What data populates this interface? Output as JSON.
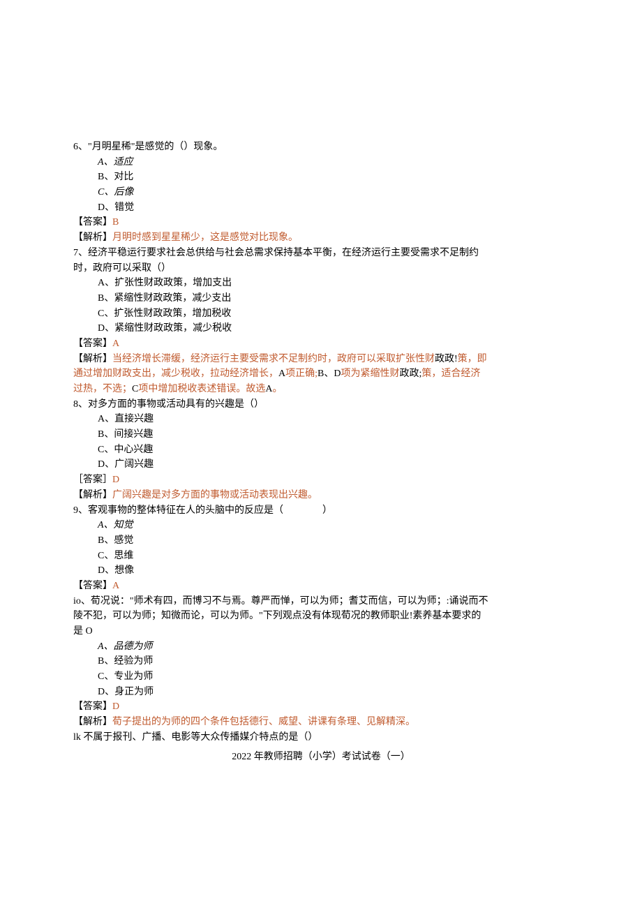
{
  "q6": {
    "stem": "6、\"月明星稀\"是感觉的（）现象。",
    "opts": {
      "A": "A、适应",
      "B": "B、对比",
      "C": "C、后像",
      "D": "D、错觉"
    },
    "ansLabel": "【答案】",
    "ansValue": "B",
    "explLabel": "【解析】",
    "explBody": "月明时感到星星稀少，这是感觉对比现象。"
  },
  "q7": {
    "stem1": "7、经济平稳运行要求社会总供给与社会总需求保持基本平衡，在经济运行主要受需求不足制约",
    "stem2": "时，政府可以采取（）",
    "opts": {
      "A": "A、扩张性财政政策，增加支出",
      "B": "B、紧缩性财政政策，减少支出",
      "C": "C、扩张性财政政策，增加税收",
      "D": "D、紧缩性财政政策，减少税收"
    },
    "ansLabel": "【答案】",
    "ansValue": "A",
    "explLabel": "【解析】",
    "expl": {
      "p1a": "当经济增长滞缓，经济运行主要受需求不足制约时，政府可以采取扩张性财",
      "p1b": "政政!",
      "p1c": "策，即",
      "p2a": "通过增加财政支出，减少税收，拉动经济增长，",
      "p2b": "A",
      "p2c": "项正确;",
      "p2d": "B、D",
      "p2e": "项为紧缩性财",
      "p2f": "政政;",
      "p2g": "策，适合经济",
      "p3a": "过热，不选；",
      "p3b": "C",
      "p3c": "项中增加税收表述错误。故选",
      "p3d": "A",
      "p3e": "。"
    }
  },
  "q8": {
    "stem": "8、对多方面的事物或活动具有的兴趣是（）",
    "opts": {
      "A": "A、直接兴趣",
      "B": "B、间接兴趣",
      "C": "C、中心兴趣",
      "D": "D、广阔兴趣"
    },
    "ansLabel": "［答案］",
    "ansValue": "D",
    "explLabel": "【解析】",
    "explBody": "广阔兴趣是对多方面的事物或活动表现出兴趣。"
  },
  "q9": {
    "stem": "9、客观事物的整体特征在人的头脑中的反应是（　　　　）",
    "opts": {
      "A": "A、知觉",
      "B": "B、感觉",
      "C": "C、思维",
      "D": "D、想像"
    },
    "ansLabel": "【答案】",
    "ansValue": "A"
  },
  "q10": {
    "stem1": "io、荀况说：\"师术有四，而博习不与焉。尊严而惮，可以为师；耆艾而信，可以为师；:诵说而不",
    "stem2": "陵不犯，可以为师；知微而论，可以为师。\"下列观点没有体现荀况的教师职业!素养基本要求的",
    "stem3": "是 O",
    "opts": {
      "A": "A、品德为师",
      "B": "B、经验为师",
      "C": "C、专业为师",
      "D": "D、身正为师"
    },
    "ansLabel": "【答案】",
    "ansValue": "D",
    "explLabel": "【解析】",
    "explBody": "荀子提出的为师的四个条件包括德行、威望、讲课有条理、见解精深。"
  },
  "q11": {
    "stem": "lk 不属于报刊、广播、电影等大众传播媒介特点的是（）"
  },
  "footer": "2022 年教师招聘（小学）考试试卷（一）"
}
